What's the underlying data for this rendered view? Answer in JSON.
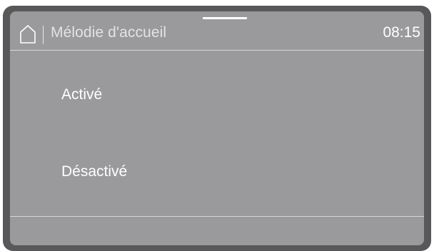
{
  "header": {
    "home_icon": "home-icon",
    "title": "Mélodie d'accueil",
    "time": "08:15"
  },
  "options": [
    {
      "label": "Activé"
    },
    {
      "label": "Désactivé"
    }
  ],
  "colors": {
    "bezel": "#58585a",
    "screen": "#9a9a9c",
    "text": "#ffffff",
    "divider": "#d8d8d8"
  }
}
